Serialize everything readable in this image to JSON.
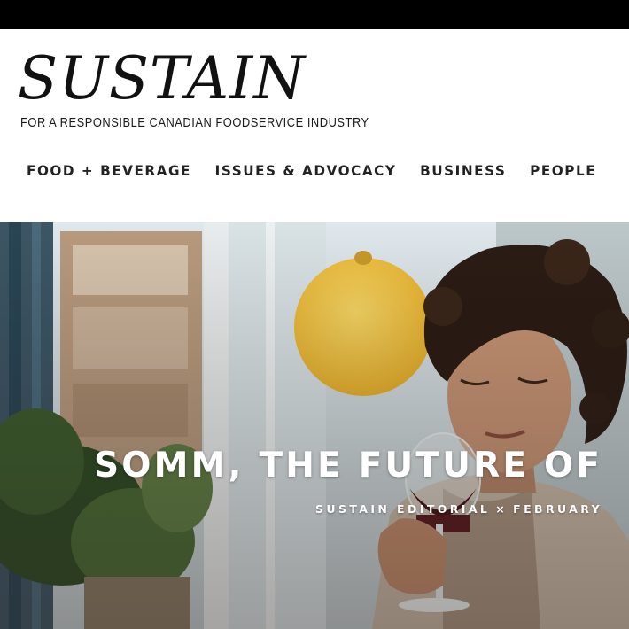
{
  "masthead": {
    "logo": "SUSTAIN",
    "tagline": "FOR A RESPONSIBLE CANADIAN FOODSERVICE INDUSTRY"
  },
  "nav": {
    "items": [
      {
        "label": "FOOD + BEVERAGE"
      },
      {
        "label": "ISSUES & ADVOCACY"
      },
      {
        "label": "BUSINESS"
      },
      {
        "label": "PEOPLE"
      }
    ]
  },
  "hero": {
    "title": "SOMM, THE FUTURE OF",
    "author": "SUSTAIN EDITORIAL",
    "separator": "×",
    "date": "FEBRUARY"
  },
  "colors": {
    "topbar": "#000000",
    "text_dark": "#222222",
    "hero_text": "#ffffff",
    "lamp": "#f2c13a"
  }
}
